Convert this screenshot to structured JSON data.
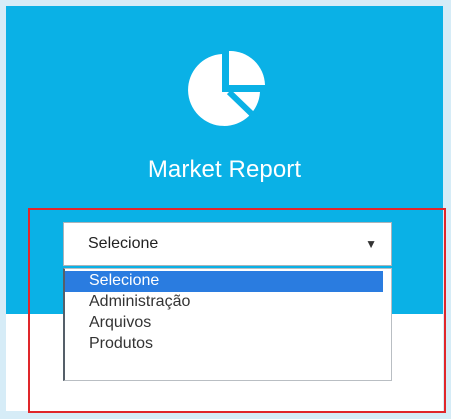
{
  "header": {
    "title": "Market Report",
    "icon": "pie-chart-icon",
    "background_color": "#0ab1e6"
  },
  "select": {
    "current_value": "Selecione",
    "arrow": "▼",
    "options": [
      "Selecione",
      "Administração",
      "Arquivos",
      "Produtos"
    ],
    "selected_index": 0
  },
  "colors": {
    "highlight_border": "#e0262a",
    "selected_option_bg": "#2a7ce0"
  }
}
